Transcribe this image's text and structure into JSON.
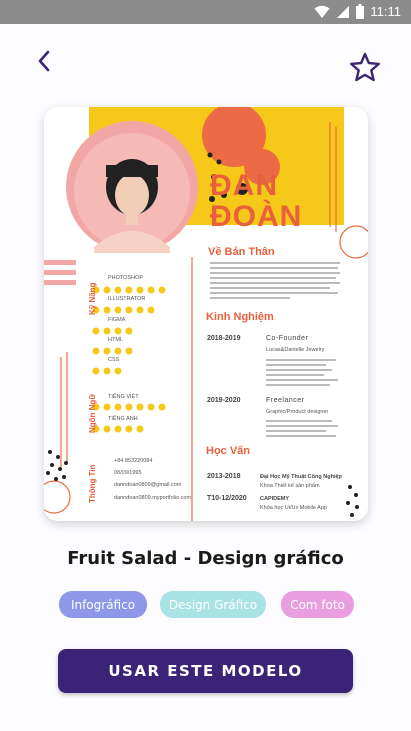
{
  "status_bar": {
    "time": "11:11"
  },
  "nav": {
    "back_icon": "chevron-left-icon",
    "favorite_icon": "star-outline-icon"
  },
  "colors": {
    "accent": "#3b2377",
    "tag_infografico": "#8e98e8",
    "tag_design": "#a9e3e3",
    "tag_foto": "#e89ee0"
  },
  "preview": {
    "name_line1": "ĐAN",
    "name_line2": "ĐOÀN",
    "about_heading": "Về Bản Thân",
    "experience_heading": "Kinh Nghiệm",
    "education_heading": "Học Vấn",
    "skills_label": "Kỹ Năng",
    "languages_label": "Ngôn Ngữ",
    "contact_label": "Thông Tin",
    "skills": [
      "PHOTOSHOP",
      "ILLUSTRATOR",
      "FIGMA",
      "HTML",
      "CSS"
    ],
    "languages": [
      "TIẾNG VIỆT",
      "TIẾNG ANH"
    ],
    "contacts": [
      "+84 853220084",
      "08/09/1995",
      "danndoan0809@gmail.com",
      "danndoan0809.myportfolio.com"
    ],
    "experience": [
      {
        "years": "2018-2019",
        "role": "Co-Founder",
        "company": "Lucas&Danielle Jewelry"
      },
      {
        "years": "2019-2020",
        "role": "Freelancer",
        "company": "Graphic/Product designer"
      }
    ],
    "education": [
      {
        "years": "2013-2018",
        "school": "Đại Học Mỹ Thuật Công Nghiệp",
        "detail": "Khoa Thiết kế sản phẩm"
      },
      {
        "years": "T10-12/2020",
        "school": "CAPIDEMY",
        "detail": "Khóa học Ui/Ux Mobile App"
      }
    ]
  },
  "template_title": "Fruit Salad - Design gráfico",
  "tags": [
    "Infográfico",
    "Design Gráfico",
    "Com foto"
  ],
  "cta_label": "USAR ESTE MODELO"
}
